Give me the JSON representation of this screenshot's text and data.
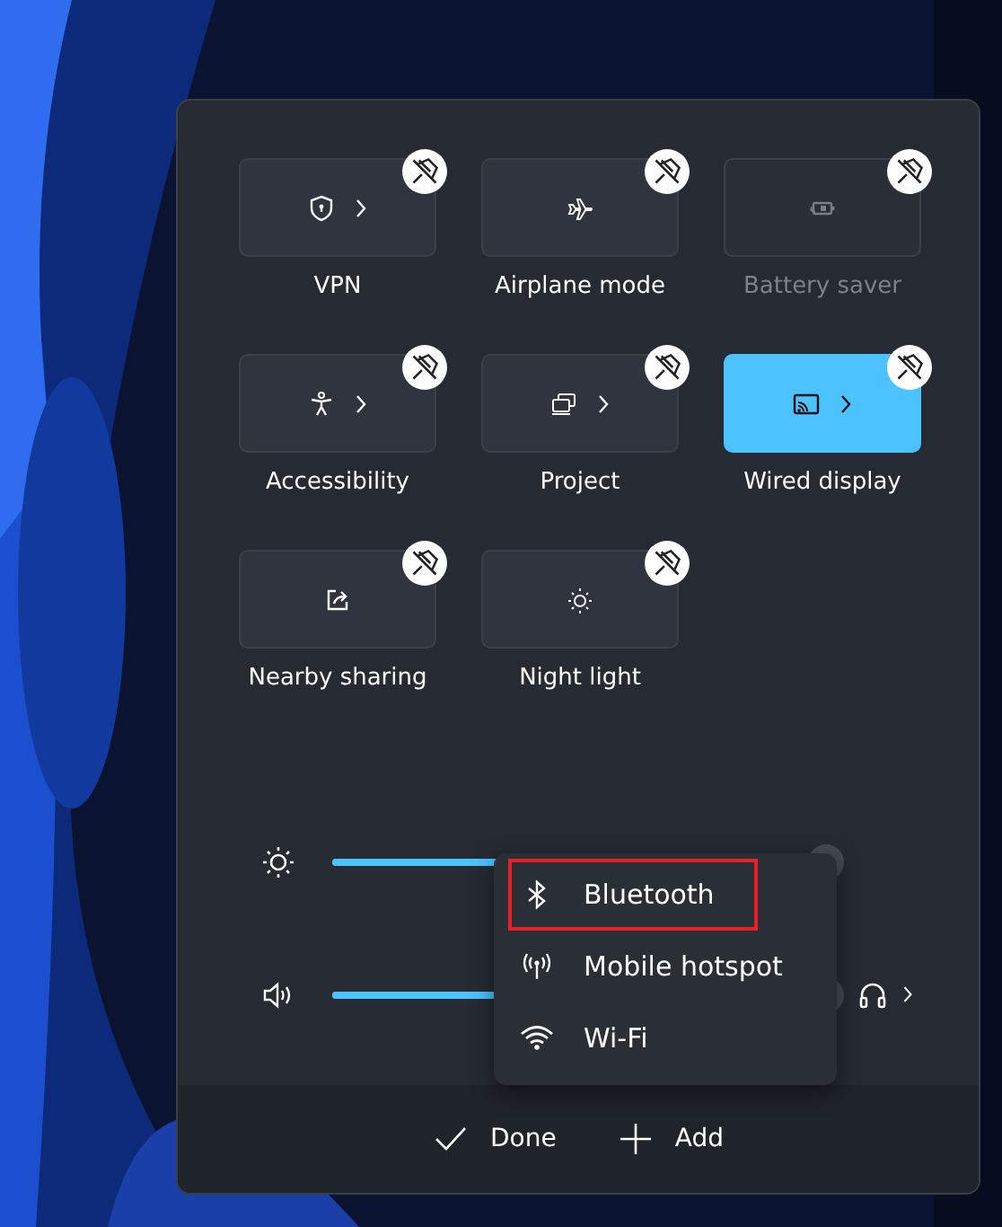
{
  "tiles": [
    {
      "label": "VPN",
      "kind": "vpn",
      "chevron": true,
      "on": false,
      "disabled": false
    },
    {
      "label": "Airplane mode",
      "kind": "airplane",
      "chevron": false,
      "on": false,
      "disabled": false
    },
    {
      "label": "Battery saver",
      "kind": "battery",
      "chevron": false,
      "on": false,
      "disabled": true
    },
    {
      "label": "Accessibility",
      "kind": "accessibility",
      "chevron": true,
      "on": false,
      "disabled": false
    },
    {
      "label": "Project",
      "kind": "project",
      "chevron": true,
      "on": false,
      "disabled": false
    },
    {
      "label": "Wired display",
      "kind": "cast",
      "chevron": true,
      "on": true,
      "disabled": false
    },
    {
      "label": "Nearby sharing",
      "kind": "share",
      "chevron": false,
      "on": false,
      "disabled": false
    },
    {
      "label": "Night light",
      "kind": "nightlight",
      "chevron": false,
      "on": false,
      "disabled": false
    }
  ],
  "sliders": [
    {
      "kind": "brightness",
      "level": 1.0
    },
    {
      "kind": "volume",
      "level": 1.0
    }
  ],
  "add_menu": {
    "items": [
      {
        "label": "Bluetooth",
        "kind": "bluetooth",
        "selected": true
      },
      {
        "label": "Mobile hotspot",
        "kind": "hotspot",
        "selected": false
      },
      {
        "label": "Wi-Fi",
        "kind": "wifi",
        "selected": false
      }
    ]
  },
  "footer": {
    "done": "Done",
    "add": "Add"
  }
}
